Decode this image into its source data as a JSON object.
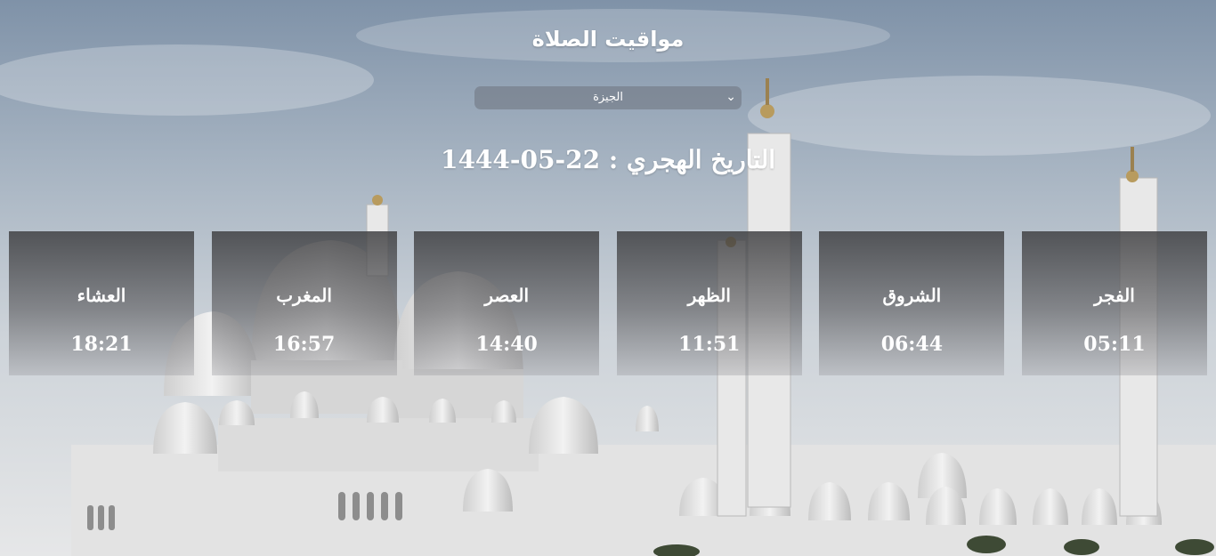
{
  "header": {
    "title": "مواقيت الصلاة"
  },
  "city_select": {
    "selected": "الجيزة"
  },
  "hijri_date": {
    "text": "التاريخ الهجري : 22-05-1444"
  },
  "prayers": [
    {
      "name": "الفجر",
      "time": "05:11"
    },
    {
      "name": "الشروق",
      "time": "06:44"
    },
    {
      "name": "الظهر",
      "time": "11:51"
    },
    {
      "name": "العصر",
      "time": "14:40"
    },
    {
      "name": "المغرب",
      "time": "16:57"
    },
    {
      "name": "العشاء",
      "time": "18:21"
    }
  ],
  "colors": {
    "text": "#ffffff",
    "card": "#3c3c3e",
    "select": "#6e737d"
  }
}
